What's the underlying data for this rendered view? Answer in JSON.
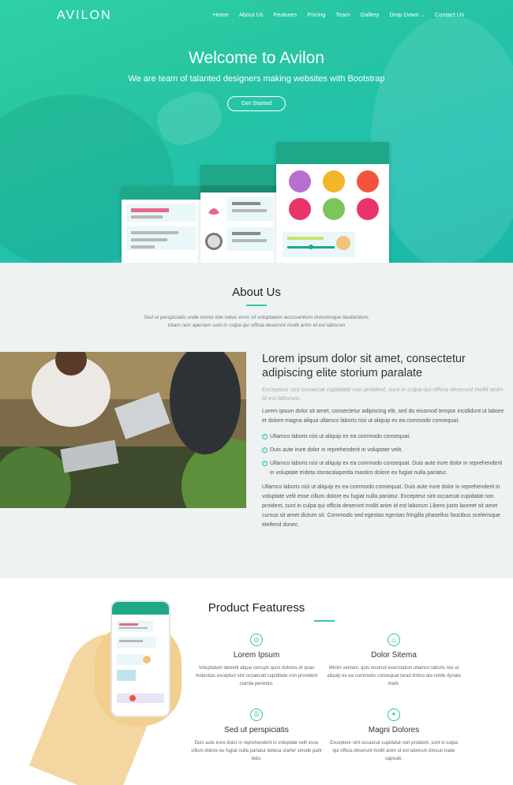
{
  "brand": "AVILON",
  "nav": [
    "Home",
    "About Us",
    "Features",
    "Pricing",
    "Team",
    "Gallery",
    "Drop Down",
    "Contact Us"
  ],
  "hero": {
    "title": "Welcome to Avilon",
    "subtitle": "We are team of talanted designers making websites with Bootstrap",
    "cta": "Get Started"
  },
  "about": {
    "title": "About Us",
    "intro": "Sed ut perspiciatis unde omnis iste natus error sit voluptatem accusantium doloremque laudantium, totam rem aperiam sunt in culpa qui officia deserunt mollit anim id est laborum",
    "heading": "Lorem ipsum dolor sit amet, consectetur adipiscing elite storium paralate",
    "lead": "Excepteur sint occaecat cupidatat non proident, sunt in culpa qui officia deserunt mollit anim id est laborum.",
    "p1": "Lorem ipsum dolor sit amet, consectetur adipiscing elit, sed do eiusmod tempor incididunt ut labore et dolore magna aliqua ullamco laboris nisi ut aliquip ex ea commodo consequat.",
    "checks": [
      "Ullamco laboris nisi ut aliquip ex ea commodo consequat.",
      "Duis aute irure dolor in reprehenderit in voluptate velit.",
      "Ullamco laboris nisi ut aliquip ex ea commodo consequat. Duis aute irure dolor in reprehenderit in voluptate trideta storacalaperda mastiro dolore eu fugiat nulla pariatur."
    ],
    "p2": "Ullamco laboris nisi ut aliquip ex ea commodo consequat. Duis aute irure dolor in reprehenderit in voluptate velit esse cillum dolore eu fugiat nulla pariatur. Excepteur sint occaecat cupidatat non proident, sunt in culpa qui officia deserunt mollit anim id est laborum Libero justo laoreet sit amet cursus sit amet dictum sit. Commodo sed egestas egestas fringilla phasellus faucibus scelerisque eleifend donec."
  },
  "features": {
    "title": "Product Featuress",
    "items": [
      {
        "title": "Lorem Ipsum",
        "desc": "Voluptatum deleniti atque corrupti quos dolores et quas molestias excepturi sint occaecati cupiditate non provident clarida perendo.",
        "icon": "radar-icon"
      },
      {
        "title": "Dolor Sitema",
        "desc": "Minim veniam, quis nostrud exercitation ullamco laboris nisi ut aliquip ex ea commodo consequat tarad limino ata noble dynala mark.",
        "icon": "flask-icon"
      },
      {
        "title": "Sed ut perspiciatis",
        "desc": "Duis aute irure dolor in reprehenderit in voluptate velit esse cillum dolore eu fugiat nulla pariatur beleca starter sinode park ledo.",
        "icon": "layers-icon"
      },
      {
        "title": "Magni Dolores",
        "desc": "Excepteur sint occaecat cupidatat non proident, sunt in culpa qui officia deserunt mollit anim id est laborum dinoun trade capsule.",
        "icon": "compass-icon"
      }
    ]
  },
  "colors": {
    "accent": "#27c5a2",
    "accent_dark": "#1fa888"
  }
}
